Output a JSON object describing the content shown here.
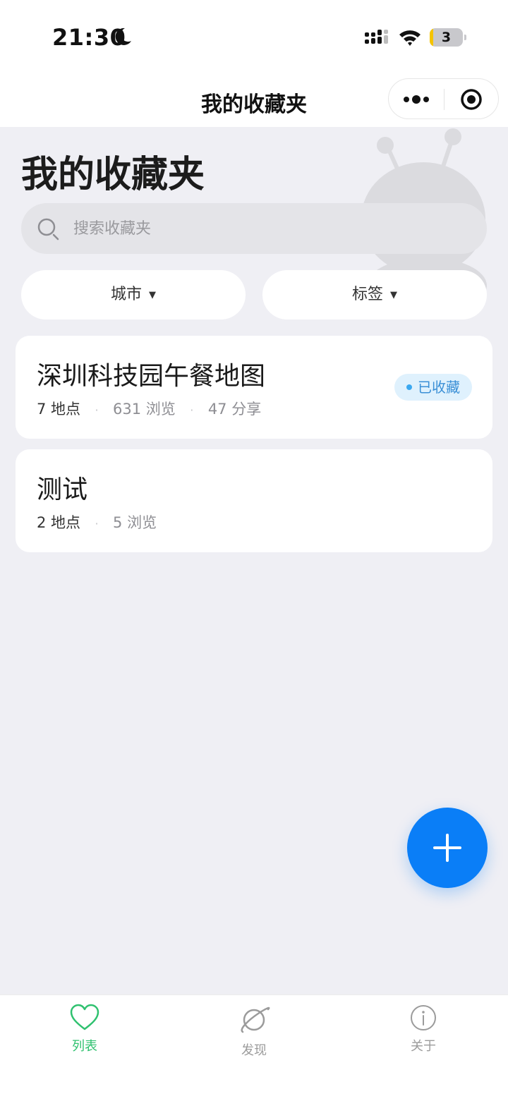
{
  "status_bar": {
    "time": "21:30",
    "battery": {
      "level": 3,
      "fill_fraction": 0.1,
      "color": "#f5c400"
    }
  },
  "navbar": {
    "title": "我的收藏夹",
    "icons": [
      "more-icon",
      "target-icon"
    ]
  },
  "page": {
    "heading": "我的收藏夹"
  },
  "search": {
    "placeholder": "搜索收藏夹",
    "value": ""
  },
  "filters": [
    {
      "label": "城市",
      "icon": "caret-down-icon"
    },
    {
      "label": "标签",
      "icon": "caret-down-icon"
    }
  ],
  "collections": [
    {
      "title": "深圳科技园午餐地图",
      "places": "7 地点",
      "views": "631 浏览",
      "shares": "47 分享",
      "badge": "已收藏"
    },
    {
      "title": "测试",
      "places": "2 地点",
      "views": "5 浏览"
    }
  ],
  "fab": {
    "icon": "plus-icon",
    "color": "#0a7ef7"
  },
  "tabbar": {
    "items": [
      {
        "label": "列表",
        "icon": "heart-icon",
        "active": true
      },
      {
        "label": "发现",
        "icon": "planet-icon",
        "active": false
      },
      {
        "label": "关于",
        "icon": "info-icon",
        "active": false
      }
    ],
    "active_color": "#2fc16f",
    "inactive_color": "#9b9b9b"
  }
}
